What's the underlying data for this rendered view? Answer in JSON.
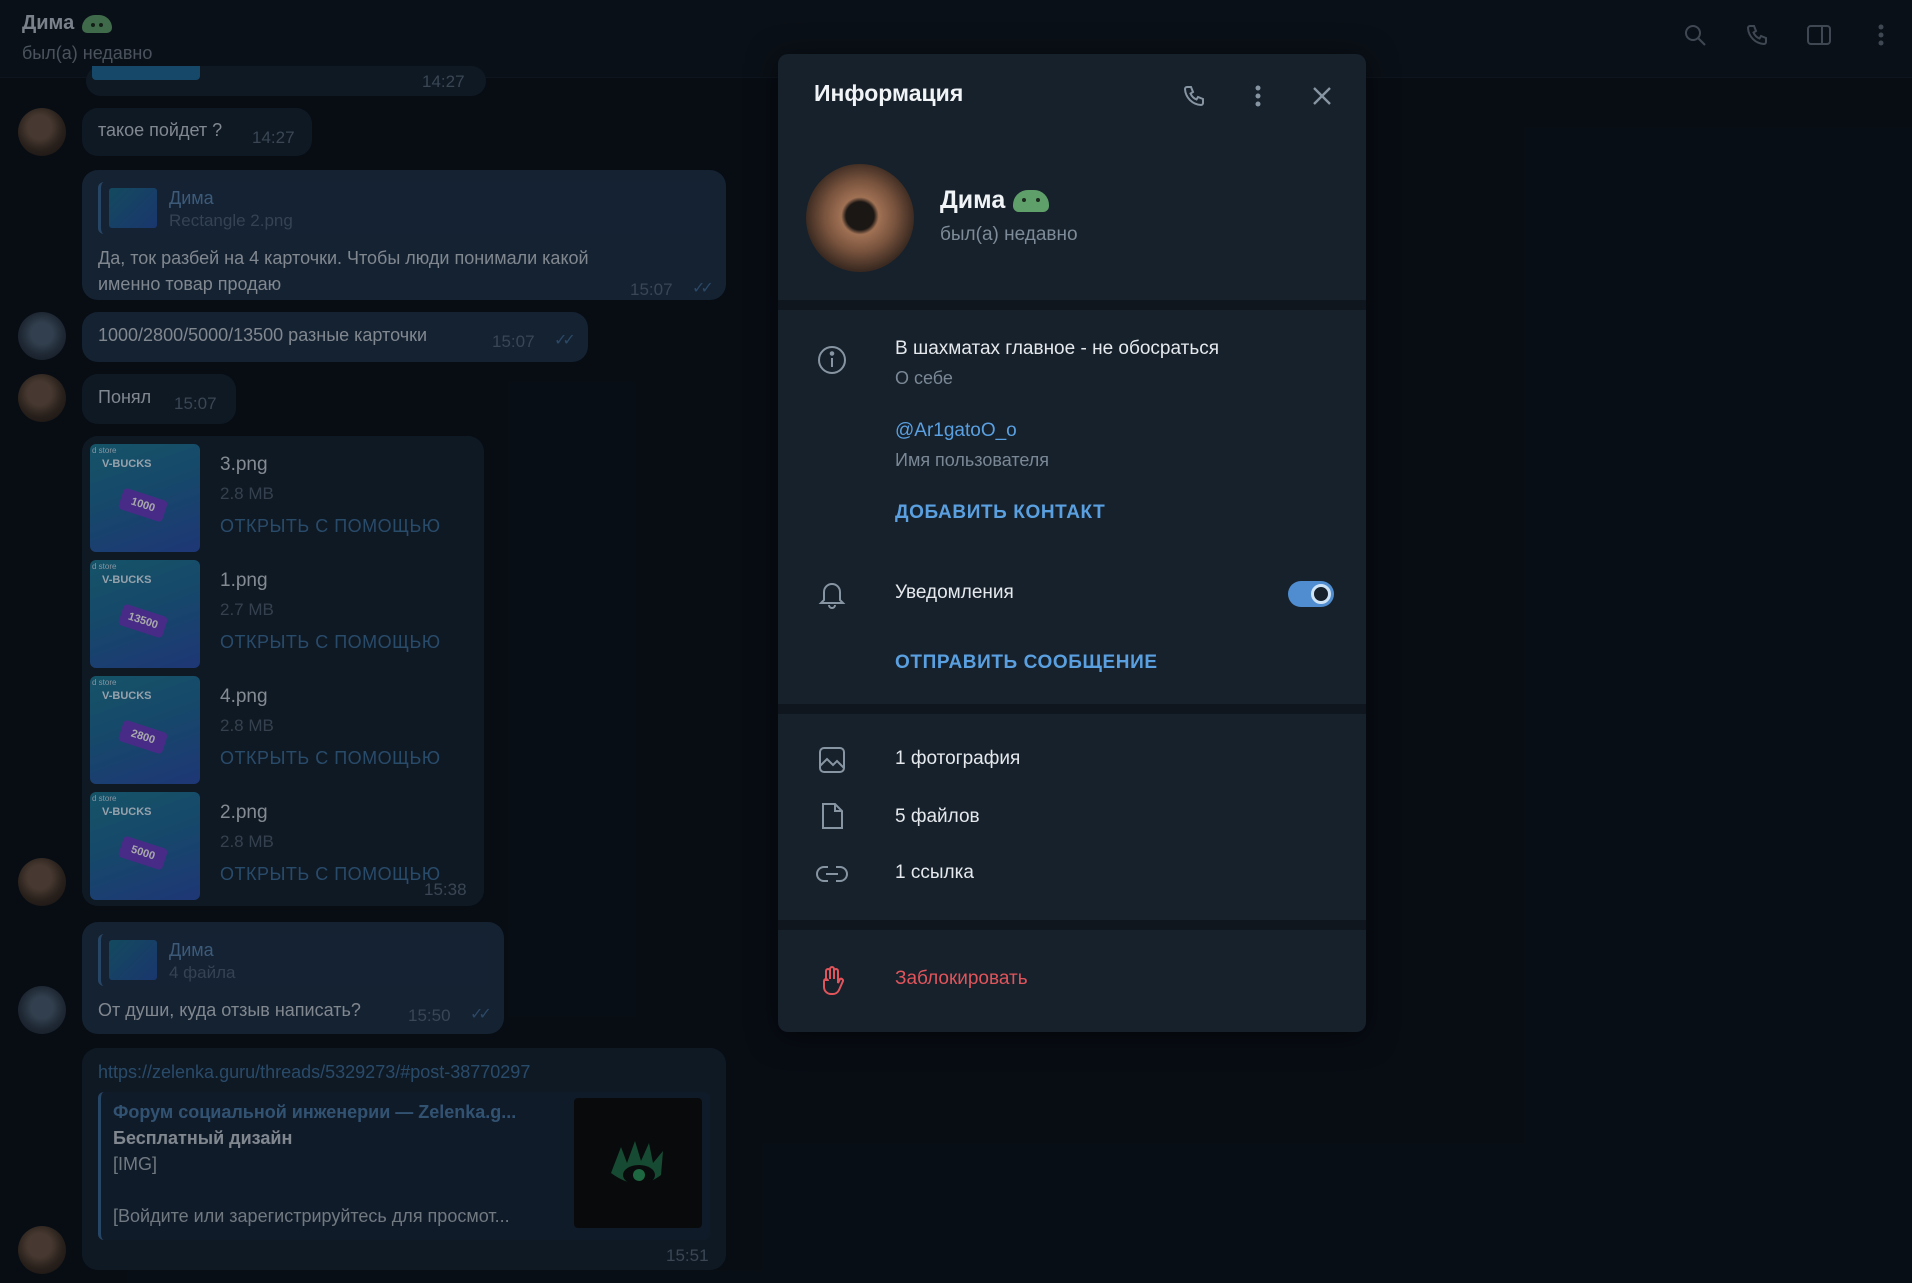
{
  "header": {
    "name": "Дима",
    "status": "был(а) недавно",
    "icons": [
      "search-icon",
      "phone-icon",
      "sidebar-icon",
      "more-icon"
    ]
  },
  "chat": {
    "messages": [
      {
        "text": "такое пойдет ?",
        "time": "14:27"
      },
      {
        "reply_name": "Дима",
        "reply_sub": "Rectangle 2.png",
        "text_line1": "Да, ток разбей на 4 карточки. Чтобы люди понимали какой",
        "text_line2": "именно товар продаю",
        "time": "15:07"
      },
      {
        "text": "1000/2800/5000/13500 разные карточки",
        "time": "15:07"
      },
      {
        "text": "Понял",
        "time": "15:07"
      },
      {
        "reply_name": "Дима",
        "reply_sub": "4 файла",
        "text": "От души, куда отзыв написать?",
        "time": "15:50"
      }
    ],
    "top_time": "14:27",
    "files": [
      {
        "name": "3.png",
        "size": "2.8 MB",
        "action": "ОТКРЫТЬ С ПОМОЩЬЮ",
        "thumb_label": "V-BUCKS",
        "thumb_value": "1000"
      },
      {
        "name": "1.png",
        "size": "2.7 MB",
        "action": "ОТКРЫТЬ С ПОМОЩЬЮ",
        "thumb_label": "V-BUCKS",
        "thumb_value": "13500"
      },
      {
        "name": "4.png",
        "size": "2.8 MB",
        "action": "ОТКРЫТЬ С ПОМОЩЬЮ",
        "thumb_label": "V-BUCKS",
        "thumb_value": "2800"
      },
      {
        "name": "2.png",
        "size": "2.8 MB",
        "action": "ОТКРЫТЬ С ПОМОЩЬЮ",
        "thumb_label": "V-BUCKS",
        "thumb_value": "5000"
      }
    ],
    "files_time": "15:38",
    "thumb_store": "d store",
    "link_message": {
      "url": "https://zelenka.guru/threads/5329273/#post-38770297",
      "preview_site": "Форум социальной инженерии — Zelenka.g...",
      "preview_title": "Бесплатный дизайн",
      "preview_line1": "[IMG]",
      "preview_line2": "[Войдите или зарегистрируйтесь для просмот...",
      "time": "15:51"
    }
  },
  "panel": {
    "title": "Информация",
    "name": "Дима",
    "status": "был(а) недавно",
    "bio": "В шахматах главное - не обосраться",
    "bio_label": "О себе",
    "username": "@Ar1gatoO_o",
    "username_label": "Имя пользователя",
    "add_contact": "ДОБАВИТЬ КОНТАКТ",
    "notifications": "Уведомления",
    "notifications_on": true,
    "send_message": "ОТПРАВИТЬ СООБЩЕНИЕ",
    "media_photos": "1 фотография",
    "media_files": "5 файлов",
    "media_links": "1 ссылка",
    "block": "Заблокировать",
    "accent_color": "#5aa0e0",
    "danger_color": "#e0545b"
  }
}
